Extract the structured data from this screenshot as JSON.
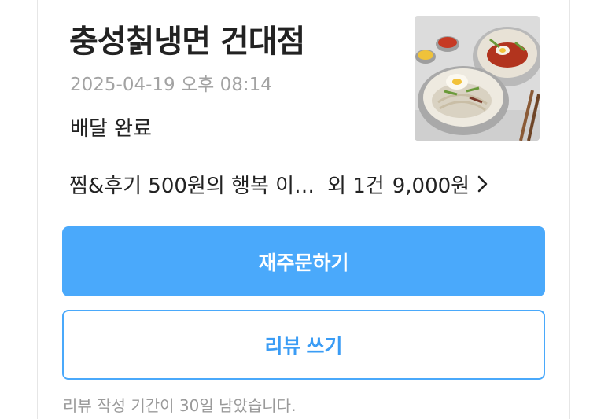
{
  "store": {
    "name": "충성칡냉면 건대점",
    "thumbnail_icon": "naengmyeon-food-photo"
  },
  "order": {
    "datetime": "2025-04-19 오후 08:14",
    "status": "배달 완료",
    "items_summary": "찜&후기 500원의 행복 이…",
    "more_count": "외 1건",
    "total_price": "9,000원",
    "chevron_icon": "chevron-right-icon"
  },
  "actions": {
    "reorder_label": "재주문하기",
    "review_label": "리뷰 쓰기"
  },
  "review_note": "리뷰 작성 기간이 30일 남았습니다.",
  "colors": {
    "primary": "#4aa9fb",
    "primary_text": "#3a9cf5",
    "muted_text": "#a3a3a3",
    "body_text": "#222222"
  }
}
